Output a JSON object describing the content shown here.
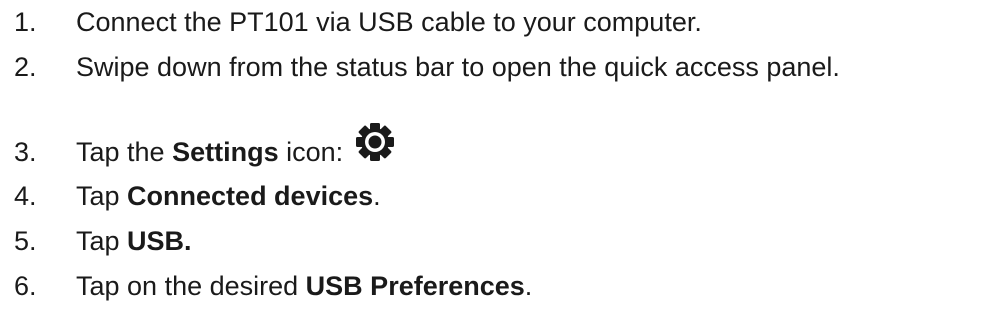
{
  "steps": [
    {
      "num": "1.",
      "text": "Connect the PT101 via USB cable to your computer."
    },
    {
      "num": "2.",
      "text": "Swipe down from the status bar to open the quick access panel."
    },
    {
      "num": "3.",
      "pre": "Tap the ",
      "bold": "Settings",
      "post": " icon:",
      "icon": "settings-gear-icon"
    },
    {
      "num": "4.",
      "pre": "Tap ",
      "bold": "Connected devices",
      "post": "."
    },
    {
      "num": "5.",
      "pre": "Tap ",
      "bold": "USB."
    },
    {
      "num": "6.",
      "pre": "Tap on the desired ",
      "bold": "USB Preferences",
      "post": "."
    }
  ]
}
